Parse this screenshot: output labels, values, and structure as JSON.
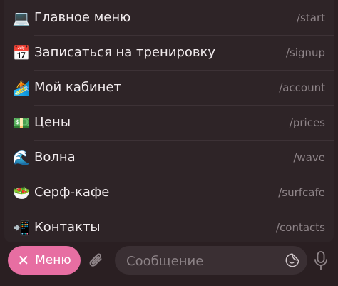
{
  "commands": [
    {
      "emoji": "💻",
      "label": "Главное меню",
      "command": "/start"
    },
    {
      "emoji": "📅",
      "label": "Записаться на тренировку",
      "command": "/signup"
    },
    {
      "emoji": "🏄",
      "label": "Мой кабинет",
      "command": "/account"
    },
    {
      "emoji": "💵",
      "label": "Цены",
      "command": "/prices"
    },
    {
      "emoji": "🌊",
      "label": "Волна",
      "command": "/wave"
    },
    {
      "emoji": "🥗",
      "label": "Серф-кафе",
      "command": "/surfcafe"
    },
    {
      "emoji": "📲",
      "label": "Контакты",
      "command": "/contacts"
    }
  ],
  "composer": {
    "menu_label": "Меню",
    "placeholder": "Сообщение",
    "accent_color": "#e76ea2"
  }
}
